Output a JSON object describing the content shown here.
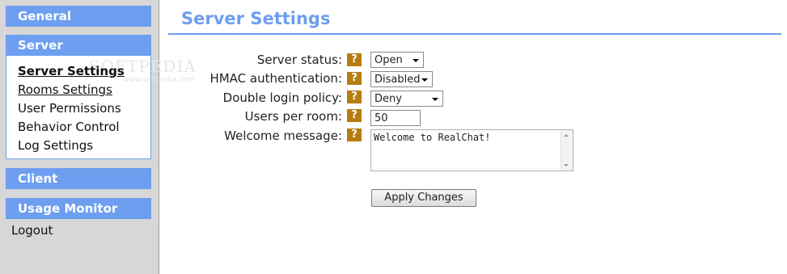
{
  "sidebar": {
    "sections": [
      {
        "label": "General"
      },
      {
        "label": "Server"
      },
      {
        "label": "Client"
      },
      {
        "label": "Usage Monitor"
      }
    ],
    "server_items": [
      {
        "label": "Server Settings"
      },
      {
        "label": "Rooms Settings"
      },
      {
        "label": "User Permissions"
      },
      {
        "label": "Behavior Control"
      },
      {
        "label": "Log Settings"
      }
    ],
    "logout": "Logout",
    "watermark": "SOFTPEDIA",
    "watermark_url": "www.softpedia.com",
    "accent_color": "#6d9ef0"
  },
  "main": {
    "title": "Server Settings",
    "help_icon": "?",
    "fields": {
      "server_status": {
        "label": "Server status:",
        "value": "Open"
      },
      "hmac": {
        "label": "HMAC authentication:",
        "value": "Disabled"
      },
      "double_login": {
        "label": "Double login policy:",
        "value": "Deny"
      },
      "users_per_room": {
        "label": "Users per room:",
        "value": "50"
      },
      "welcome": {
        "label": "Welcome message:",
        "value": "Welcome to RealChat!"
      }
    },
    "apply_label": "Apply Changes"
  }
}
